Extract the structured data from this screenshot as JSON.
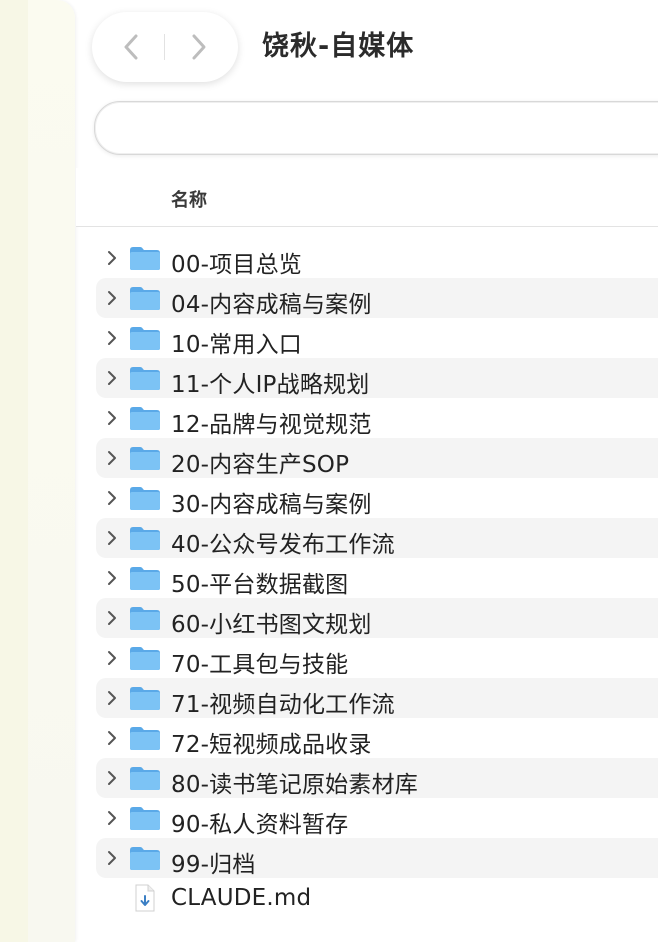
{
  "window": {
    "title": "饶秋-自媒体"
  },
  "toolbar": {
    "back_icon": "chevron-left-icon",
    "forward_icon": "chevron-right-icon"
  },
  "columns": {
    "name": "名称"
  },
  "colors": {
    "folder": "#5aa9e8",
    "folder_light": "#7cc3f5",
    "row_alt": "#f4f4f4",
    "sidebar": "#f8f8ec"
  },
  "files": [
    {
      "name": "00-项目总览",
      "type": "folder"
    },
    {
      "name": "04-内容成稿与案例",
      "type": "folder"
    },
    {
      "name": "10-常用入口",
      "type": "folder"
    },
    {
      "name": "11-个人IP战略规划",
      "type": "folder"
    },
    {
      "name": "12-品牌与视觉规范",
      "type": "folder"
    },
    {
      "name": "20-内容生产SOP",
      "type": "folder"
    },
    {
      "name": "30-内容成稿与案例",
      "type": "folder"
    },
    {
      "name": "40-公众号发布工作流",
      "type": "folder"
    },
    {
      "name": "50-平台数据截图",
      "type": "folder"
    },
    {
      "name": "60-小红书图文规划",
      "type": "folder"
    },
    {
      "name": "70-工具包与技能",
      "type": "folder"
    },
    {
      "name": "71-视频自动化工作流",
      "type": "folder"
    },
    {
      "name": "72-短视频成品收录",
      "type": "folder"
    },
    {
      "name": "80-读书笔记原始素材库",
      "type": "folder"
    },
    {
      "name": "90-私人资料暂存",
      "type": "folder"
    },
    {
      "name": "99-归档",
      "type": "folder"
    },
    {
      "name": "CLAUDE.md",
      "type": "file"
    }
  ]
}
